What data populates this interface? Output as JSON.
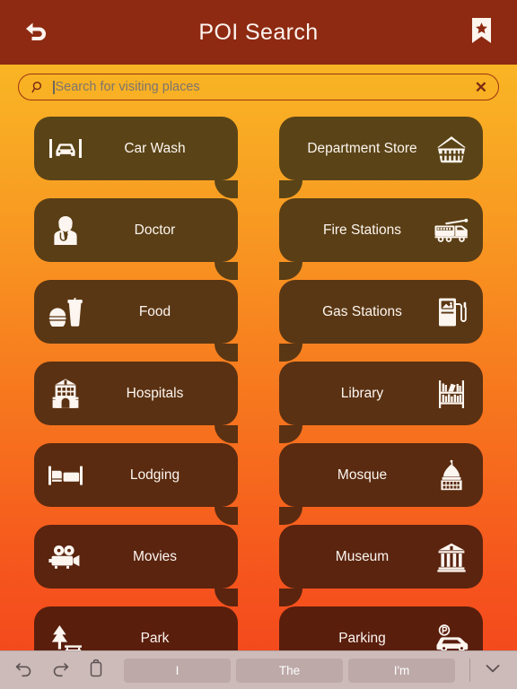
{
  "navbar": {
    "title": "POI Search",
    "back_icon": "undo-back-arrow-icon",
    "bookmark_icon": "bookmark-star-icon",
    "background_color": "#8E2A12",
    "title_color": "#FDF4EE"
  },
  "search": {
    "placeholder": "Search for visiting places",
    "value": "",
    "icon": "search-icon",
    "clear_label": "✕",
    "border_color": "#9A3412"
  },
  "theme": {
    "gradient_top": "#F9BC26",
    "gradient_bottom": "#F4451D",
    "button_top": "#5A4417",
    "button_bottom": "#5A1E0D",
    "button_text": "#FDF6F0"
  },
  "poi_rows": [
    [
      {
        "label": "Car Wash",
        "icon": "car-wash-icon",
        "side": "left"
      },
      {
        "label": "Department Store",
        "icon": "shopping-basket-icon",
        "side": "right"
      }
    ],
    [
      {
        "label": "Doctor",
        "icon": "doctor-icon",
        "side": "left"
      },
      {
        "label": "Fire Stations",
        "icon": "fire-truck-icon",
        "side": "right"
      }
    ],
    [
      {
        "label": "Food",
        "icon": "burger-drink-icon",
        "side": "left"
      },
      {
        "label": "Gas Stations",
        "icon": "fuel-pump-icon",
        "side": "right"
      }
    ],
    [
      {
        "label": "Hospitals",
        "icon": "hospital-building-icon",
        "side": "left"
      },
      {
        "label": "Library",
        "icon": "bookshelf-icon",
        "side": "right"
      }
    ],
    [
      {
        "label": "Lodging",
        "icon": "bed-icon",
        "side": "left"
      },
      {
        "label": "Mosque",
        "icon": "domed-mosque-icon",
        "side": "right"
      }
    ],
    [
      {
        "label": "Movies",
        "icon": "movie-camera-icon",
        "side": "left"
      },
      {
        "label": "Museum",
        "icon": "museum-building-icon",
        "side": "right"
      }
    ],
    [
      {
        "label": "Park",
        "icon": "park-tree-icon",
        "side": "left"
      },
      {
        "label": "Parking",
        "icon": "parking-car-icon",
        "side": "right"
      }
    ]
  ],
  "keyboard_bar": {
    "undo_icon": "undo-icon",
    "redo_icon": "redo-icon",
    "paste_icon": "paste-clipboard-icon",
    "suggestions": [
      "I",
      "The",
      "I'm"
    ],
    "dismiss_icon": "chevron-down-icon",
    "background_color": "#CDBBBA"
  }
}
